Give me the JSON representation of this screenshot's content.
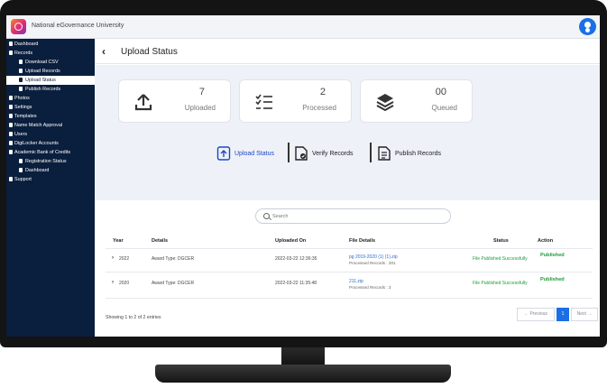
{
  "app": {
    "title": "National eGovernance University"
  },
  "sidebar": {
    "items": [
      {
        "label": "Dashboard"
      },
      {
        "label": "Records"
      },
      {
        "label": "Download CSV"
      },
      {
        "label": "Upload Records"
      },
      {
        "label": "Upload Status"
      },
      {
        "label": "Publish Records"
      },
      {
        "label": "Photos"
      },
      {
        "label": "Settings"
      },
      {
        "label": "Templates"
      },
      {
        "label": "Name Match Approval"
      },
      {
        "label": "Users"
      },
      {
        "label": "DigiLocker Accounts"
      },
      {
        "label": "Academic Bank of Credits"
      },
      {
        "label": "Registration Status"
      },
      {
        "label": "Dashboard"
      },
      {
        "label": "Support"
      }
    ],
    "active_index": 4
  },
  "page": {
    "title": "Upload Status"
  },
  "stats": [
    {
      "value": "7",
      "label": "Uploaded",
      "icon": "upload-icon"
    },
    {
      "value": "2",
      "label": "Processed",
      "icon": "checklist-icon"
    },
    {
      "value": "00",
      "label": "Queued",
      "icon": "layers-icon"
    }
  ],
  "actions": [
    {
      "label": "Upload Status",
      "icon": "upload-file-icon"
    },
    {
      "label": "Verify Records",
      "icon": "verify-file-icon"
    },
    {
      "label": "Publish Records",
      "icon": "publish-file-icon"
    }
  ],
  "search": {
    "placeholder": "Search"
  },
  "table": {
    "headers": [
      "Year",
      "Details",
      "Uploaded On",
      "File Details",
      "Status",
      "Action"
    ],
    "rows": [
      {
        "year": "2022",
        "details": "Award Type: DGCER",
        "uploaded_on": "2022-03-22 12:36:35",
        "file_name": "pg 2019-2020 (1) (1).zip",
        "file_sub": "Processed Records : 301",
        "status": "File Published Successfully",
        "action": "Published"
      },
      {
        "year": "2020",
        "details": "Award Type: DGCER",
        "uploaded_on": "2022-03-22 11:35:48",
        "file_name": "211.zip",
        "file_sub": "Processed Records : 3",
        "status": "File Published Successfully",
        "action": "Published"
      }
    ]
  },
  "footer": {
    "info": "Showing 1 to 2 of 2 entries",
    "previous": "← Previous",
    "page": "1",
    "next": "Next →"
  },
  "colors": {
    "sidebar_bg": "#0a1e3d",
    "accent": "#1b6fe6",
    "published_green": "#1f9a3a",
    "content_bg": "#eef1f8"
  }
}
